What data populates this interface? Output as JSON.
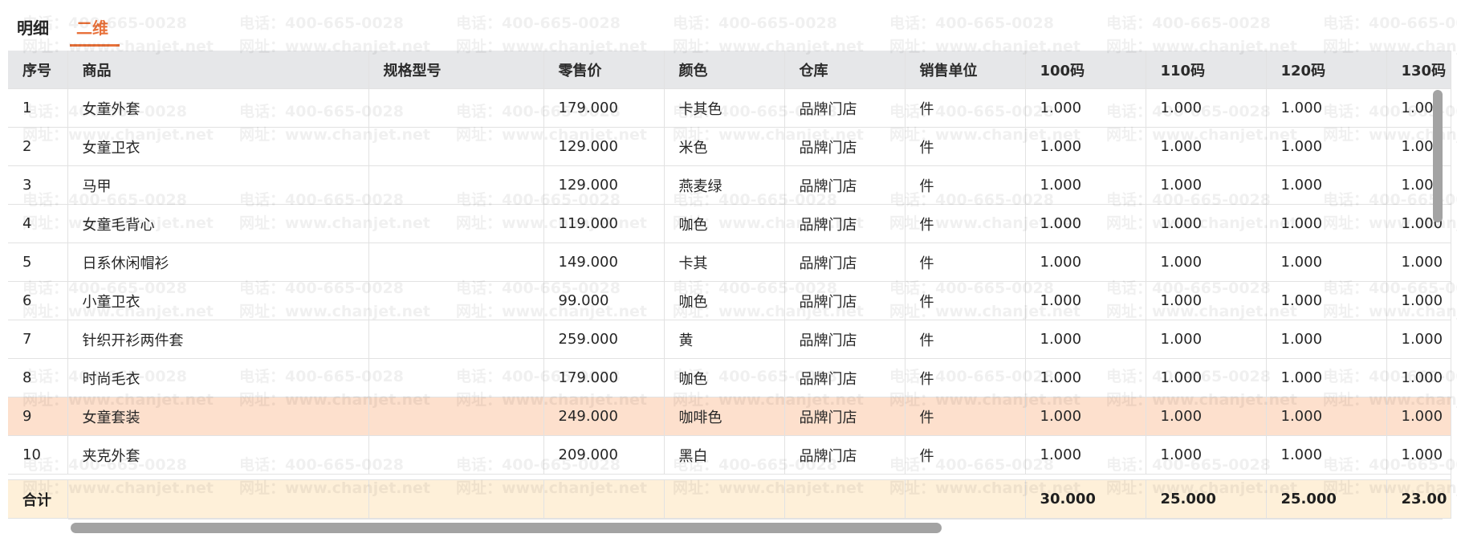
{
  "tabs": [
    {
      "label": "明细",
      "active": false
    },
    {
      "label": "二维",
      "active": true
    }
  ],
  "table": {
    "columns": [
      "序号",
      "商品",
      "规格型号",
      "零售价",
      "颜色",
      "仓库",
      "销售单位",
      "100码",
      "110码",
      "120码",
      "130码"
    ],
    "rows": [
      [
        "1",
        "女童外套",
        "",
        "179.000",
        "卡其色",
        "品牌门店",
        "件",
        "1.000",
        "1.000",
        "1.000",
        "1.000"
      ],
      [
        "2",
        "女童卫衣",
        "",
        "129.000",
        "米色",
        "品牌门店",
        "件",
        "1.000",
        "1.000",
        "1.000",
        "1.000"
      ],
      [
        "3",
        "马甲",
        "",
        "129.000",
        "燕麦绿",
        "品牌门店",
        "件",
        "1.000",
        "1.000",
        "1.000",
        "1.000"
      ],
      [
        "4",
        "女童毛背心",
        "",
        "119.000",
        "咖色",
        "品牌门店",
        "件",
        "1.000",
        "1.000",
        "1.000",
        "1.000"
      ],
      [
        "5",
        "日系休闲帽衫",
        "",
        "149.000",
        "卡其",
        "品牌门店",
        "件",
        "1.000",
        "1.000",
        "1.000",
        "1.000"
      ],
      [
        "6",
        "小童卫衣",
        "",
        "99.000",
        "咖色",
        "品牌门店",
        "件",
        "1.000",
        "1.000",
        "1.000",
        "1.000"
      ],
      [
        "7",
        "针织开衫两件套",
        "",
        "259.000",
        "黄",
        "品牌门店",
        "件",
        "1.000",
        "1.000",
        "1.000",
        "1.000"
      ],
      [
        "8",
        "时尚毛衣",
        "",
        "179.000",
        "咖色",
        "品牌门店",
        "件",
        "1.000",
        "1.000",
        "1.000",
        "1.000"
      ],
      [
        "9",
        "女童套装",
        "",
        "249.000",
        "咖啡色",
        "品牌门店",
        "件",
        "1.000",
        "1.000",
        "1.000",
        "1.000"
      ],
      [
        "10",
        "夹克外套",
        "",
        "209.000",
        "黑白",
        "品牌门店",
        "件",
        "1.000",
        "1.000",
        "1.000",
        "1.000"
      ]
    ],
    "selected_row": 8,
    "total": {
      "label": "合计",
      "values": [
        "30.000",
        "25.000",
        "25.000",
        "23.00"
      ]
    }
  },
  "watermark": {
    "phone": "电话：400-665-0028",
    "site": "网址：www.chanjet.net"
  },
  "colors": {
    "accent": "#e8713a",
    "header_bg": "#e6e7e9",
    "selected_row_bg": "#fde0cd",
    "total_row_bg": "#fef0d9"
  }
}
